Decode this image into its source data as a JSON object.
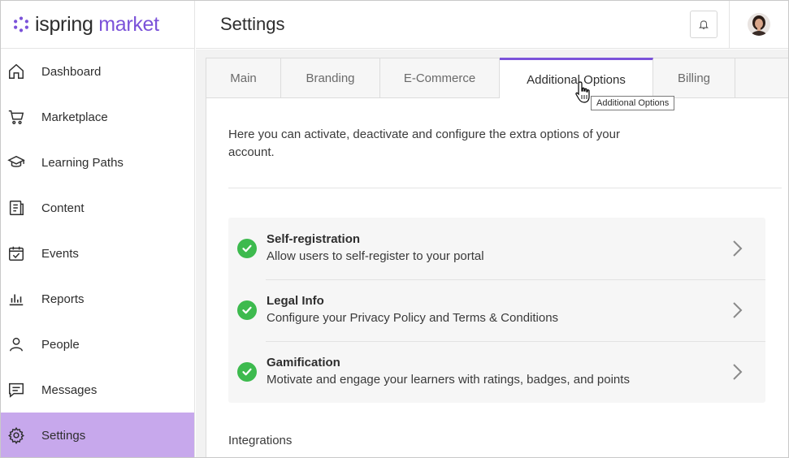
{
  "brand": {
    "name_part1": "ispring",
    "name_part2": " market",
    "color": "#7b52d9"
  },
  "sidebar": {
    "items": [
      {
        "label": "Dashboard",
        "icon": "home-icon"
      },
      {
        "label": "Marketplace",
        "icon": "cart-icon"
      },
      {
        "label": "Learning Paths",
        "icon": "graduation-cap-icon"
      },
      {
        "label": "Content",
        "icon": "document-icon"
      },
      {
        "label": "Events",
        "icon": "calendar-check-icon"
      },
      {
        "label": "Reports",
        "icon": "bar-chart-icon"
      },
      {
        "label": "People",
        "icon": "person-icon"
      },
      {
        "label": "Messages",
        "icon": "message-icon"
      },
      {
        "label": "Settings",
        "icon": "gear-icon",
        "active": true
      }
    ],
    "active_color": "#c7a8ec"
  },
  "header": {
    "title": "Settings"
  },
  "tabs": [
    {
      "label": "Main"
    },
    {
      "label": "Branding"
    },
    {
      "label": "E-Commerce"
    },
    {
      "label": "Additional Options",
      "active": true
    },
    {
      "label": "Billing"
    }
  ],
  "tooltip": "Additional Options",
  "intro": "Here you can activate, deactivate and configure the extra options of your account.",
  "options": [
    {
      "title": "Self-registration",
      "desc": "Allow users to self-register to your portal",
      "enabled": true
    },
    {
      "title": "Legal Info",
      "desc": "Configure your Privacy Policy and Terms & Conditions",
      "enabled": true
    },
    {
      "title": "Gamification",
      "desc": "Motivate and engage your learners with ratings, badges, and points",
      "enabled": true
    }
  ],
  "section_integrations": "Integrations",
  "colors": {
    "check": "#3dba4e",
    "accent": "#7b52d9"
  }
}
